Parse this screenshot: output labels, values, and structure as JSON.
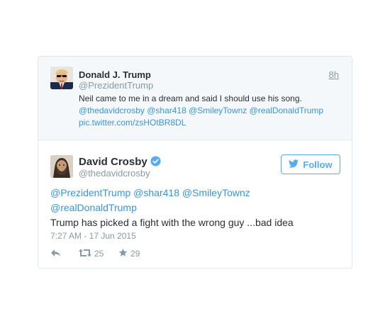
{
  "quoted_tweet": {
    "name": "Donald J. Trump",
    "handle": "@PrezidentTrump",
    "time": "8h",
    "text_line1": "Neil came to me in a dream and said I should use his song.",
    "mentions_line": "@thedavidcrosby @shar418 @SmileyTownz @realDonaldTrump",
    "pic_link": "pic.twitter.com/zsHOtBR8DL"
  },
  "tweet": {
    "name": "David Crosby",
    "handle": "@thedavidcrosby",
    "follow_label": "Follow",
    "mentions_line1": "@PrezidentTrump @shar418 @SmileyTownz",
    "mentions_line2": "@realDonaldTrump",
    "body": "Trump has picked a fight with the wrong guy ...bad idea",
    "timestamp": "7:27 AM - 17 Jun 2015",
    "retweets": "25",
    "favorites": "29"
  },
  "colors": {
    "link": "#3b94d9",
    "accent": "#55acee",
    "muted": "#8899a6",
    "text": "#292f33"
  },
  "icons": {
    "verified": "verified-badge-icon",
    "follow": "twitter-bird-icon",
    "reply": "reply-icon",
    "retweet": "retweet-icon",
    "favorite": "star-icon"
  }
}
